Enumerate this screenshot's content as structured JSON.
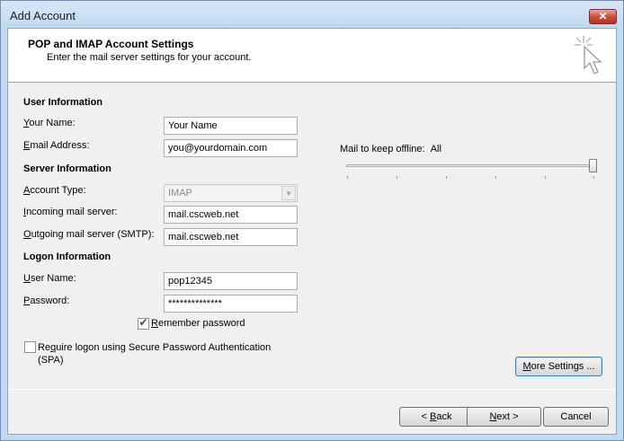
{
  "window": {
    "title": "Add Account",
    "close_glyph": "✕"
  },
  "header": {
    "title": "POP and IMAP Account Settings",
    "subtitle": "Enter the mail server settings for your account.",
    "icon": "cursor-sparkle-icon"
  },
  "user_info": {
    "heading": "User Information",
    "name_label": {
      "mnemonic": "Y",
      "rest": "our Name:"
    },
    "name_value": "Your Name",
    "email_label": {
      "mnemonic": "E",
      "rest": "mail Address:"
    },
    "email_value": "you@yourdomain.com"
  },
  "server_info": {
    "heading": "Server Information",
    "account_type_label": {
      "mnemonic": "A",
      "rest": "ccount Type:"
    },
    "account_type_value": "IMAP",
    "incoming_label": {
      "mnemonic": "I",
      "rest": "ncoming mail server:"
    },
    "incoming_value": "mail.cscweb.net",
    "outgoing_label": {
      "mnemonic": "O",
      "rest": "utgoing mail server (SMTP):"
    },
    "outgoing_value": "mail.cscweb.net"
  },
  "logon_info": {
    "heading": "Logon Information",
    "username_label": {
      "mnemonic": "U",
      "rest": "ser Name:"
    },
    "username_value": "pop12345",
    "password_label": {
      "mnemonic": "P",
      "rest": "assword:"
    },
    "password_value": "**************",
    "remember": {
      "mnemonic": "R",
      "rest": "emember password",
      "checked": true
    },
    "spa": {
      "pre": "Re",
      "mnemonic": "q",
      "rest": "uire logon using Secure Password Authentication",
      "line2": "(SPA)",
      "checked": false
    }
  },
  "offline": {
    "label": "Mail to keep offline:",
    "value": "All",
    "slider_fraction": 1.0
  },
  "buttons": {
    "more_settings": {
      "mnemonic": "M",
      "rest": "ore Settings ..."
    },
    "back": {
      "pre": "< ",
      "mnemonic": "B",
      "rest": "ack"
    },
    "next": {
      "mnemonic": "N",
      "rest": "ext >"
    },
    "cancel": "Cancel"
  }
}
